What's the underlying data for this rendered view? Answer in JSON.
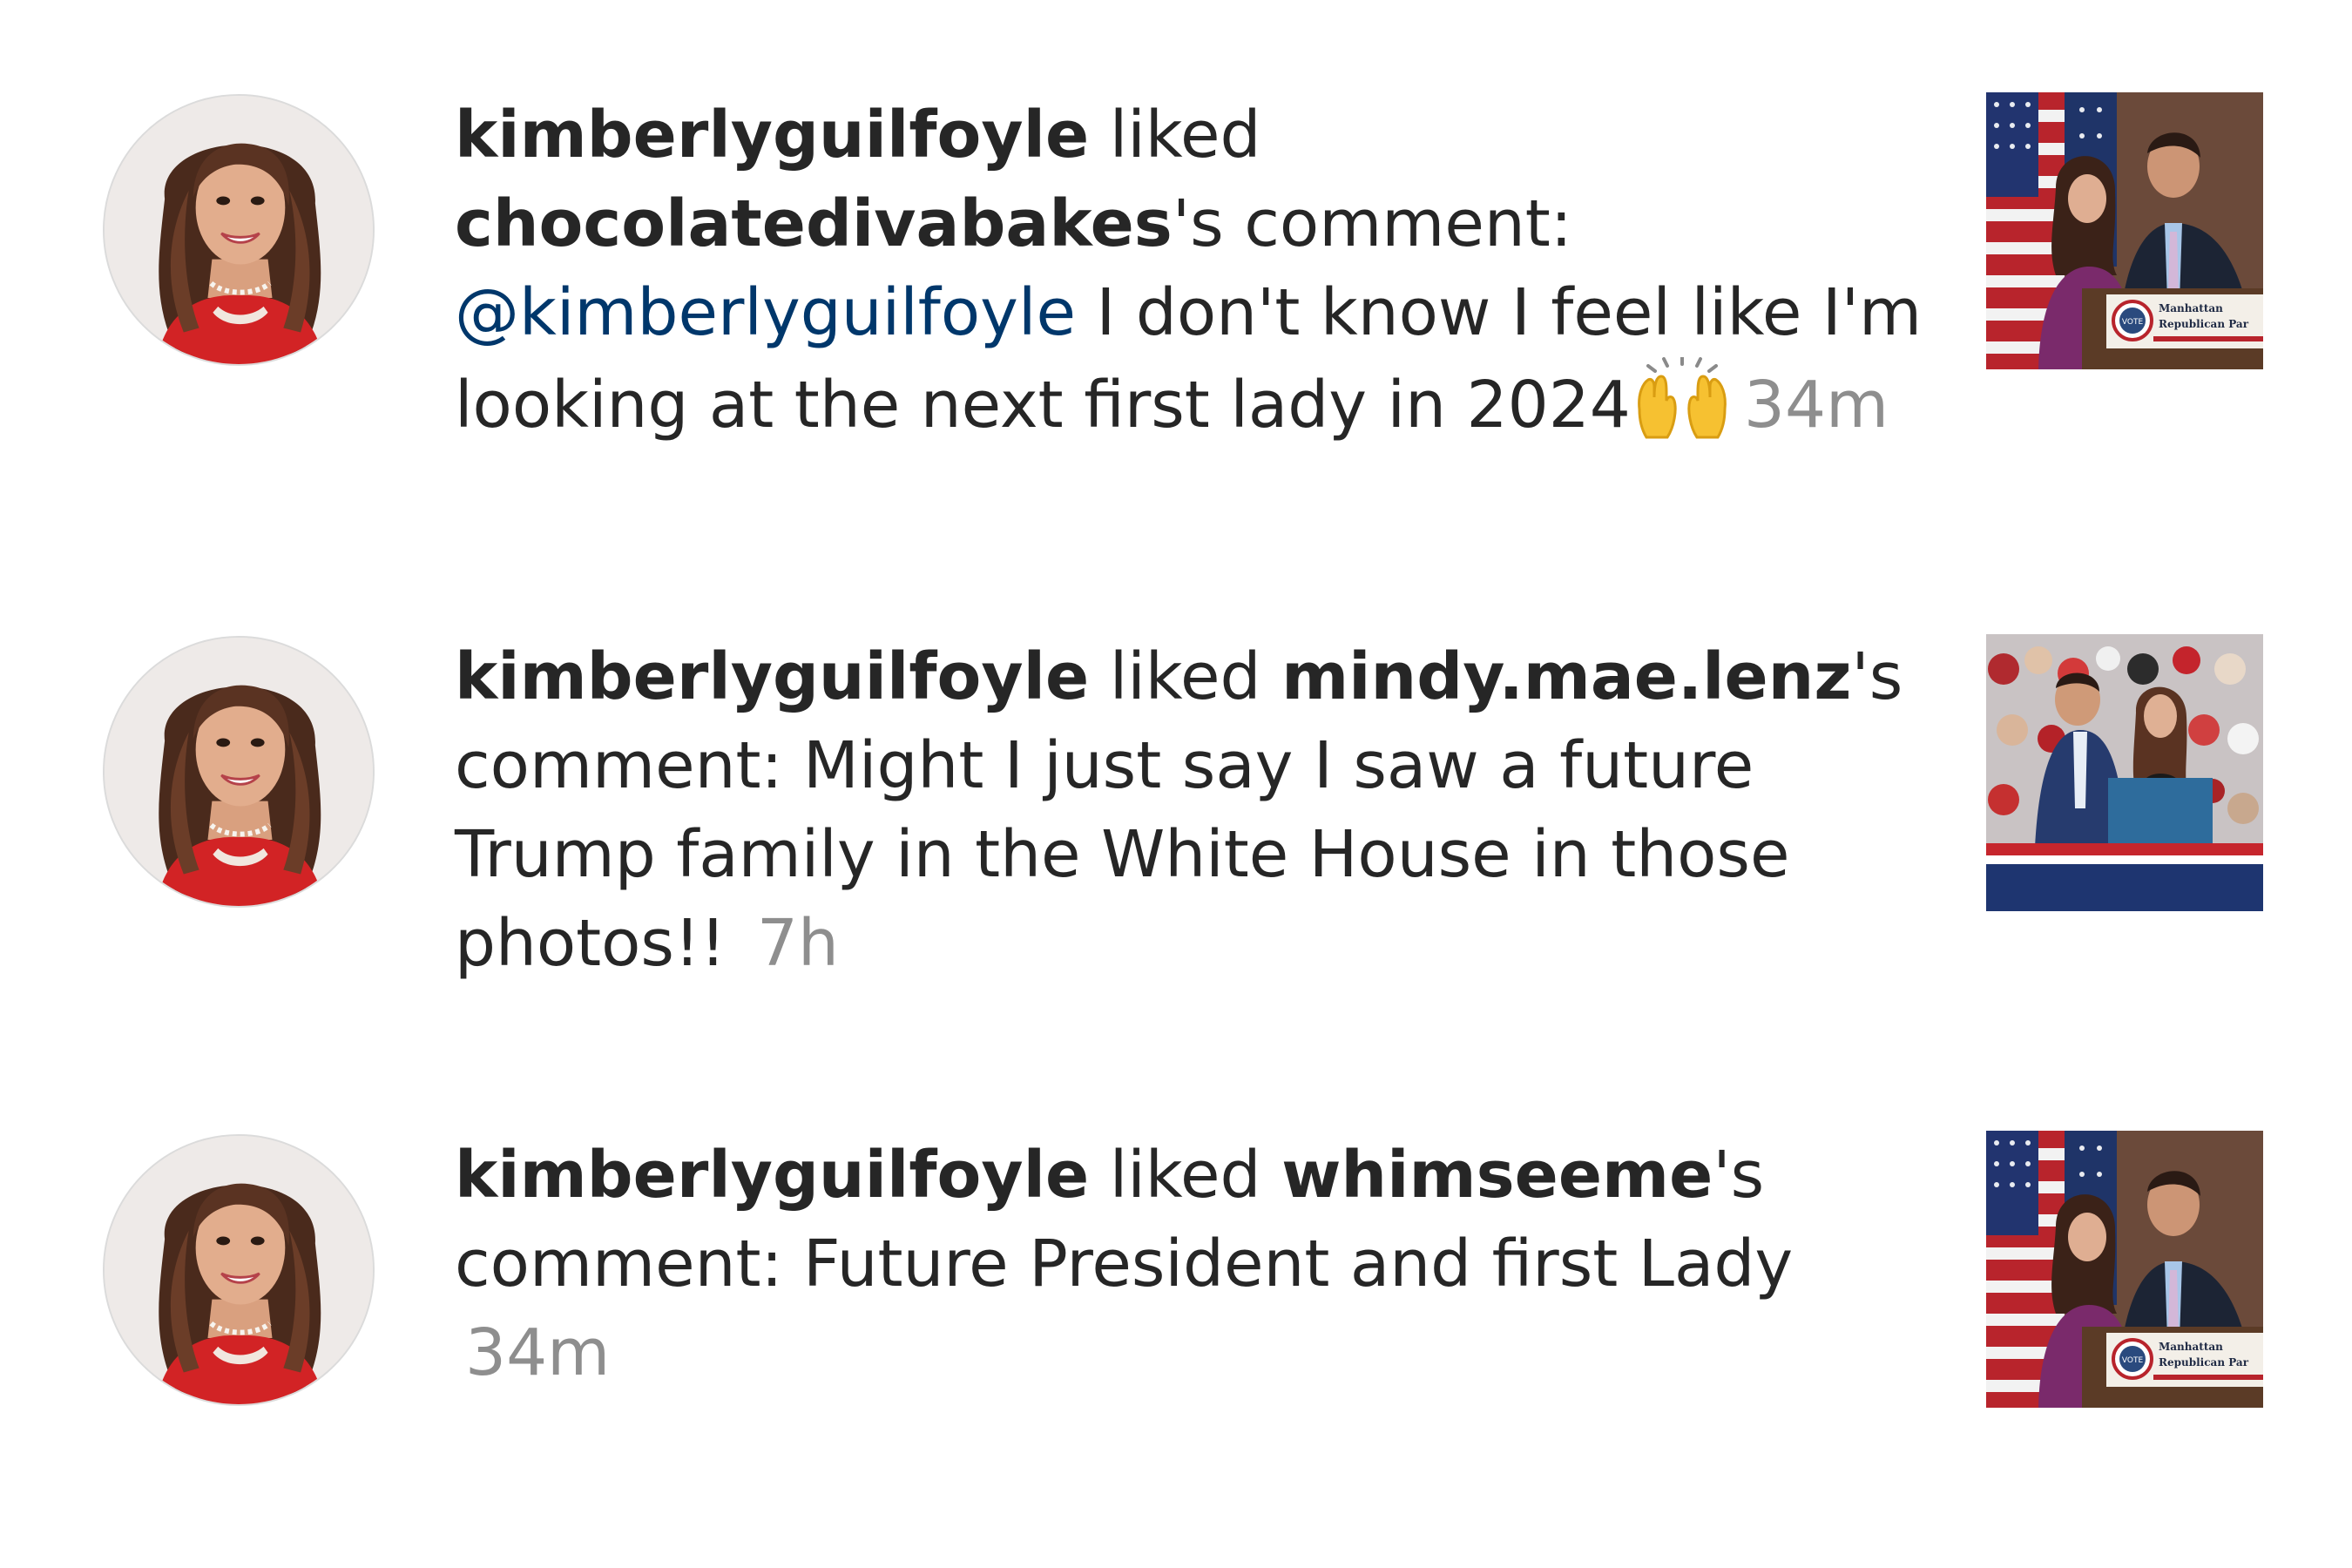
{
  "notifications": [
    {
      "actor": "kimberlyguilfoyle",
      "verb": "liked",
      "target_user": "chocolatedivabakes",
      "suffix": "'s comment:",
      "mention": "@kimberlyguilfoyle",
      "comment": "I don't know I feel like I'm looking at the next first lady in 2024",
      "emoji": "🙌",
      "time": "34m",
      "thumbnail": {
        "scene": "flag-podium",
        "podium_sign_line1": "Manhattan",
        "podium_sign_line2": "Republican Par",
        "podium_sign_badge": "VOTE"
      }
    },
    {
      "actor": "kimberlyguilfoyle",
      "verb": "liked",
      "target_user": "mindy.mae.lenz",
      "suffix": "'s comment:",
      "comment": "Might I just say I saw a future Trump family in the White House in those photos!!",
      "time": "7h",
      "thumbnail": {
        "scene": "rally-stage"
      }
    },
    {
      "actor": "kimberlyguilfoyle",
      "verb": "liked",
      "target_user": "whimseeme",
      "suffix": "'s comment:",
      "comment": "Future President and first Lady",
      "time": "34m",
      "thumbnail": {
        "scene": "flag-podium",
        "podium_sign_line1": "Manhattan",
        "podium_sign_line2": "Republican Par",
        "podium_sign_badge": "VOTE"
      }
    }
  ],
  "colors": {
    "text": "#262626",
    "mention": "#00376b",
    "timestamp": "#8e8e8e",
    "background": "#ffffff"
  }
}
